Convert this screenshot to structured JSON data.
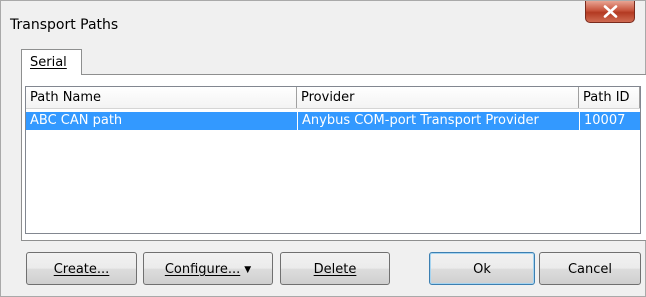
{
  "window": {
    "title": "Transport Paths"
  },
  "tabs": [
    {
      "label": "Serial",
      "selected": true
    }
  ],
  "list": {
    "columns": [
      "Path Name",
      "Provider",
      "Path ID"
    ],
    "rows": [
      {
        "path_name": "ABC CAN path",
        "provider": "Anybus COM-port Transport Provider",
        "path_id": "10007",
        "selected": true
      }
    ]
  },
  "buttons": {
    "create": "Create...",
    "configure": "Configure...",
    "delete": "Delete",
    "ok": "Ok",
    "cancel": "Cancel"
  },
  "icons": {
    "close": "close-icon",
    "dropdown": "chevron-down-icon"
  },
  "colors": {
    "selection": "#3399ff",
    "close_button": "#c7543c"
  }
}
